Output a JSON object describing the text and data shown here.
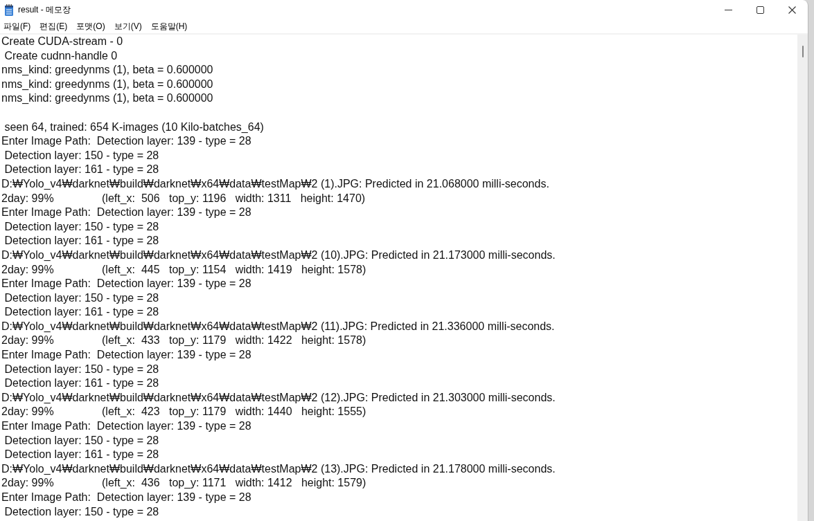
{
  "window": {
    "title": "result - 메모장"
  },
  "menu_bar": [
    "파일(F)",
    "편집(E)",
    "포맷(O)",
    "보기(V)",
    "도움말(H)"
  ],
  "editor": {
    "sections": [
      {
        "lines": [
          "Create CUDA-stream - 0",
          " Create cudnn-handle 0",
          "nms_kind: greedynms (1), beta = 0.600000",
          "nms_kind: greedynms (1), beta = 0.600000",
          "nms_kind: greedynms (1), beta = 0.600000"
        ]
      },
      {
        "lines": [
          " seen 64, trained: 654 K-images (10 Kilo-batches_64)",
          "Enter Image Path:  Detection layer: 139 - type = 28",
          " Detection layer: 150 - type = 28",
          " Detection layer: 161 - type = 28",
          "D:₩Yolo_v4₩darknet₩build₩darknet₩x64₩data₩testMap₩2 (1).JPG: Predicted in 21.068000 milli-seconds.",
          "2day: 99%\t(left_x:  506   top_y: 1196   width: 1311   height: 1470)",
          "Enter Image Path:  Detection layer: 139 - type = 28",
          " Detection layer: 150 - type = 28",
          " Detection layer: 161 - type = 28",
          "D:₩Yolo_v4₩darknet₩build₩darknet₩x64₩data₩testMap₩2 (10).JPG: Predicted in 21.173000 milli-seconds.",
          "2day: 99%\t(left_x:  445   top_y: 1154   width: 1419   height: 1578)",
          "Enter Image Path:  Detection layer: 139 - type = 28",
          " Detection layer: 150 - type = 28",
          " Detection layer: 161 - type = 28",
          "D:₩Yolo_v4₩darknet₩build₩darknet₩x64₩data₩testMap₩2 (11).JPG: Predicted in 21.336000 milli-seconds.",
          "2day: 99%\t(left_x:  433   top_y: 1179   width: 1422   height: 1578)",
          "Enter Image Path:  Detection layer: 139 - type = 28",
          " Detection layer: 150 - type = 28",
          " Detection layer: 161 - type = 28",
          "D:₩Yolo_v4₩darknet₩build₩darknet₩x64₩data₩testMap₩2 (12).JPG: Predicted in 21.303000 milli-seconds.",
          "2day: 99%\t(left_x:  423   top_y: 1179   width: 1440   height: 1555)",
          "Enter Image Path:  Detection layer: 139 - type = 28",
          " Detection layer: 150 - type = 28",
          " Detection layer: 161 - type = 28",
          "D:₩Yolo_v4₩darknet₩build₩darknet₩x64₩data₩testMap₩2 (13).JPG: Predicted in 21.178000 milli-seconds.",
          "2day: 99%\t(left_x:  436   top_y: 1171   width: 1412   height: 1579)",
          "Enter Image Path:  Detection layer: 139 - type = 28",
          " Detection layer: 150 - type = 28"
        ]
      }
    ]
  }
}
